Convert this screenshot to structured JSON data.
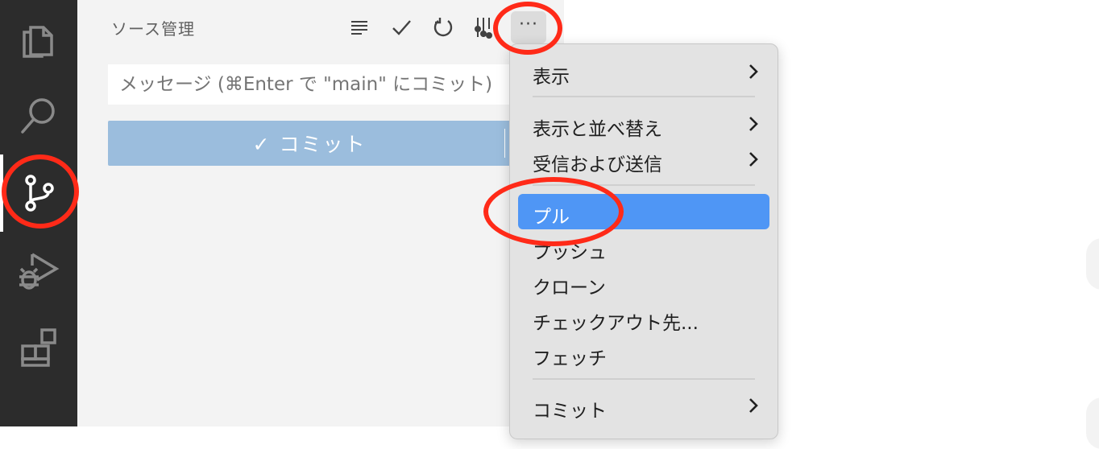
{
  "activity_bar": {
    "items": [
      {
        "name": "explorer",
        "icon": "files-icon"
      },
      {
        "name": "search",
        "icon": "search-icon"
      },
      {
        "name": "source-control",
        "icon": "source-control-icon",
        "active": true
      },
      {
        "name": "run-debug",
        "icon": "run-debug-icon"
      },
      {
        "name": "extensions",
        "icon": "extensions-icon"
      }
    ]
  },
  "sidebar": {
    "title": "ソース管理",
    "actions": [
      {
        "icon": "list-icon"
      },
      {
        "icon": "check-icon"
      },
      {
        "icon": "refresh-icon"
      },
      {
        "icon": "graph-icon"
      },
      {
        "icon": "more-icon",
        "label": "···"
      }
    ],
    "message_placeholder": "メッセージ (⌘Enter で \"main\" にコミット)",
    "commit_button": "✓ コミット"
  },
  "context_menu": {
    "items": [
      {
        "label": "表示",
        "submenu": true
      },
      {
        "label": "表示と並べ替え",
        "submenu": true
      },
      {
        "label": "受信および送信",
        "submenu": true
      },
      {
        "label": "プル",
        "highlighted": true
      },
      {
        "label": "プッシュ"
      },
      {
        "label": "クローン"
      },
      {
        "label": "チェックアウト先..."
      },
      {
        "label": "フェッチ"
      },
      {
        "label": "コミット",
        "submenu": true
      }
    ]
  },
  "colors": {
    "activity_bg": "#2c2c2c",
    "sidebar_bg": "#f3f3f3",
    "commit_button": "#9bbddd",
    "menu_highlight": "#4f96f5",
    "annotation_red": "#ff2a18"
  }
}
